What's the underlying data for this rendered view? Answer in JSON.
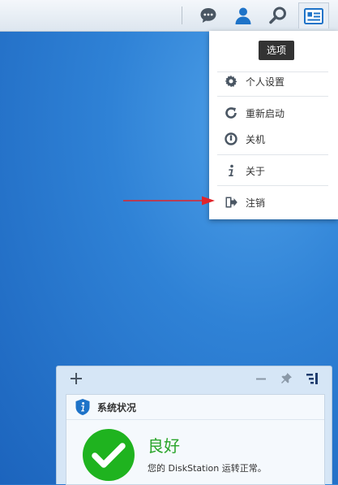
{
  "taskbar": {
    "icons": [
      "chat-icon",
      "user-icon",
      "search-icon",
      "options-icon"
    ]
  },
  "menu": {
    "tooltip": "选项",
    "items": [
      {
        "label": "个人设置",
        "icon": "gear-icon"
      },
      {
        "label": "重新启动",
        "icon": "restart-icon"
      },
      {
        "label": "关机",
        "icon": "power-icon"
      },
      {
        "label": "关于",
        "icon": "info-icon"
      },
      {
        "label": "注销",
        "icon": "logout-icon"
      }
    ]
  },
  "widget": {
    "title": "系统状况",
    "status": "良好",
    "description": "您的 DiskStation 运转正常。"
  },
  "colors": {
    "desktop": "#2f82d6",
    "status_good": "#2aa52a",
    "arrow": "#e0242a",
    "accent": "#1e73c8"
  }
}
